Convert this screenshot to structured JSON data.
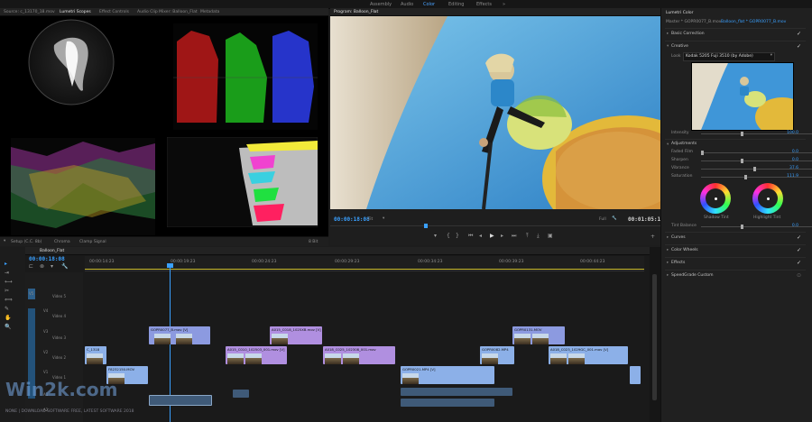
{
  "workspaces": {
    "assembly": "Assembly",
    "audio": "Audio",
    "color": "Color",
    "editing": "Editing",
    "effects": "Effects",
    "more": "»"
  },
  "source_panel": {
    "tabs": [
      "Source: c_13170_18.mov",
      "Lumetri Scopes",
      "Effect Controls",
      "Audio Clip Mixer: Balloon_Flat",
      "Metadata"
    ],
    "active_tab": 1
  },
  "program": {
    "tab": "Program: Balloon_Flat",
    "close": "≡",
    "timecode_in": "00:00:18:08",
    "fit": "Fit",
    "quality": "Full",
    "timecode_out": "00:01:05:18"
  },
  "scope_bar": {
    "setup": "Setup (C.C. 8b)",
    "chroma": "Chroma",
    "clamp": "Clamp Signal",
    "bits": "8 Bit"
  },
  "timeline": {
    "tab": "Balloon_Flat",
    "timecode": "00:00:18:08",
    "ruler": [
      "00:00:14:23",
      "00:00:19:23",
      "00:00:24:23",
      "00:00:29:23",
      "00:00:34:23",
      "00:00:39:23",
      "00:00:44:23"
    ],
    "tracks": [
      {
        "id": "V5",
        "name": "Video 5"
      },
      {
        "id": "V4",
        "name": "Video 4"
      },
      {
        "id": "V3",
        "name": "Video 3"
      },
      {
        "id": "V2",
        "name": "Video 2"
      },
      {
        "id": "V1",
        "name": "Video 1"
      },
      {
        "id": "A1",
        "name": ""
      },
      {
        "id": "A2",
        "name": ""
      }
    ],
    "clips": {
      "c1": "GOPR0077_B.mov [V]",
      "c2": "A015_C018_1025XB.mov [V]",
      "c3": "GOPR0131.MOV",
      "c4": "C_1318",
      "c5": "A015_C010_102503_001.mov [V]",
      "c6": "A018_C025_102308_001.mov",
      "c7": "GOPR0082.MP4",
      "c8": "A018_C023_1029GC_001.mov [V]",
      "c9": "F8232150.MOV",
      "c10": "GOPR0021.MP4 [V]"
    }
  },
  "lumetri": {
    "title": "Lumetri Color",
    "master": "Master * GOPR0077_B.mov",
    "seq": "Balloon_flat * GOPR0077_B.mov",
    "basic": "Basic Correction",
    "creative": "Creative",
    "look_label": "Look",
    "look_value": "Kodak 5205 Fuji 3510 (by Adobe)",
    "intensity_label": "Intensity",
    "intensity": "100.0",
    "adjustments": "Adjustments",
    "sliders": [
      {
        "label": "Faded Film",
        "value": "0.0"
      },
      {
        "label": "Sharpen",
        "value": "0.0"
      },
      {
        "label": "Vibrance",
        "value": "37.6"
      },
      {
        "label": "Saturation",
        "value": "111.9"
      }
    ],
    "shadow_tint": "Shadow Tint",
    "highlight_tint": "Highlight Tint",
    "tint_balance": "Tint Balance",
    "tint_value": "0.0",
    "sections": [
      "Curves",
      "Color Wheels",
      "Effects",
      "SpeedGrade Custom"
    ]
  },
  "watermark": {
    "brand": "Win2k.com",
    "tagline": "NONE | DOWNLOAD SOFTWARE FREE, LATEST SOFTWARE 2018"
  },
  "colors": {
    "accent": "#3aa0ff",
    "clip_video": "#8c9ae0",
    "clip_lavender": "#b08fe0",
    "clip_audio": "#3f5a78"
  }
}
